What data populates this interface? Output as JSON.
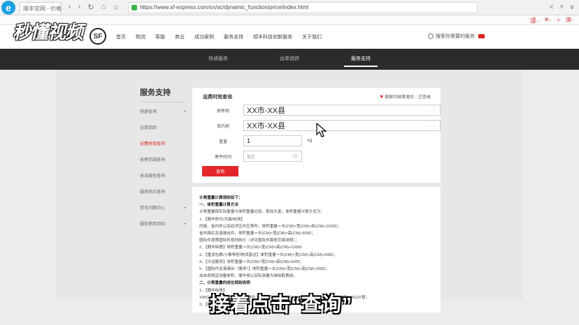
{
  "browser": {
    "logo": "e",
    "tab_title": "顺丰官网 - 价格",
    "url": "https://www.sf-express.com/cn/sc/dynamic_function/price/index.html",
    "nav": [
      "‹",
      "›",
      "↻",
      "⌂",
      "☆"
    ],
    "tools": [
      "<",
      "⚡",
      "∨"
    ],
    "extensions": [
      "译·",
      "✕·",
      "⌕",
      "⊞·"
    ]
  },
  "watermark": "秒懂视频",
  "site": {
    "logo": "SF",
    "nav": [
      "首页",
      "物流",
      "客服",
      "商业",
      "成功案例",
      "服务支持",
      "顺丰科技创新服务",
      "关于我们"
    ],
    "search": "搜索你需要的服务",
    "subnav": [
      "快递服务",
      "运单追踪",
      "服务支持"
    ],
    "subnav_active": 2
  },
  "sidebar": {
    "title": "服务支持",
    "items": [
      {
        "label": "快递查询",
        "arrow": "+"
      },
      {
        "label": "运单追踪",
        "arrow": ""
      },
      {
        "label": "运费时效查询",
        "arrow": ""
      },
      {
        "label": "收寄范围查询",
        "arrow": ""
      },
      {
        "label": "收派服务查询",
        "arrow": ""
      },
      {
        "label": "服务网点查询",
        "arrow": ""
      },
      {
        "label": "常见问题中心",
        "arrow": "+"
      },
      {
        "label": "服务使用须知",
        "arrow": "+"
      }
    ],
    "active": 2
  },
  "query": {
    "title": "运费时效查询",
    "help_link": "搜索中国港澳台…已签收",
    "origin_label": "原寄地",
    "origin_value": "XX市-XX县",
    "dest_label": "目的地",
    "dest_value": "XX市-XX县",
    "weight_label": "重量",
    "weight_value": "1",
    "weight_unit": "kg",
    "time_label": "寄件时间",
    "time_placeholder": "现在",
    "submit": "查询"
  },
  "rules": {
    "lines": [
      {
        "text": "计费重量计算规则如下：",
        "bold": true
      },
      {
        "text": "一、体积重量计算方法",
        "bold": true
      },
      {
        "text": "计费重量按实际重量与体积重量比较，取较大者；体积重量计算方式为：",
        "bold": false
      },
      {
        "text": "1、【顺丰即日/次晨/标快】",
        "bold": false
      },
      {
        "text": "同城、省内件以及经济区内互寄件，体积重量＝长(CM)×宽(CM)×高(CM)÷12000；",
        "bold": false
      },
      {
        "text": "省外跨区及港澳台件，体积重量＝长(CM)×宽(CM)×高(CM)÷6000；",
        "bold": false
      },
      {
        "text": "国际件按照国际件规则执行（详见国际件服务页面说明）；",
        "bold": false
      },
      {
        "text": "2、【顺丰特惠】体积重量＝长(CM)×宽(CM)×高(CM)÷12000",
        "bold": false
      },
      {
        "text": "3、【重货包裹/小票零担/物流普运】体积重量＝长(CM)×宽(CM)×高(CM)÷6000；",
        "bold": false
      },
      {
        "text": "4、【冷运服务】体积重量＝长(CM)×宽(CM)×高(CM)÷5000；",
        "bold": false
      },
      {
        "text": "5、【国际件及港澳台（服务）】体积重量＝长(CM)×宽(CM)×高(CM)÷5000；",
        "bold": false
      },
      {
        "text": "如未按规定测量体积，顺丰将以实际测量为准收取费用。",
        "bold": false
      },
      {
        "text": "二、计费重量的进位规则说明",
        "bold": true
      },
      {
        "text": "1、【顺丰标快】",
        "bold": false
      },
      {
        "text": "10KG以下，以0.1KG为计重单位；10KG及以上，以0.5KG为计重单位，不足0.5KG按0.5KG计算；",
        "bold": false
      },
      {
        "text": "2、【顺丰特惠】",
        "bold": false
      }
    ]
  },
  "caption": "接着点击“查询”"
}
